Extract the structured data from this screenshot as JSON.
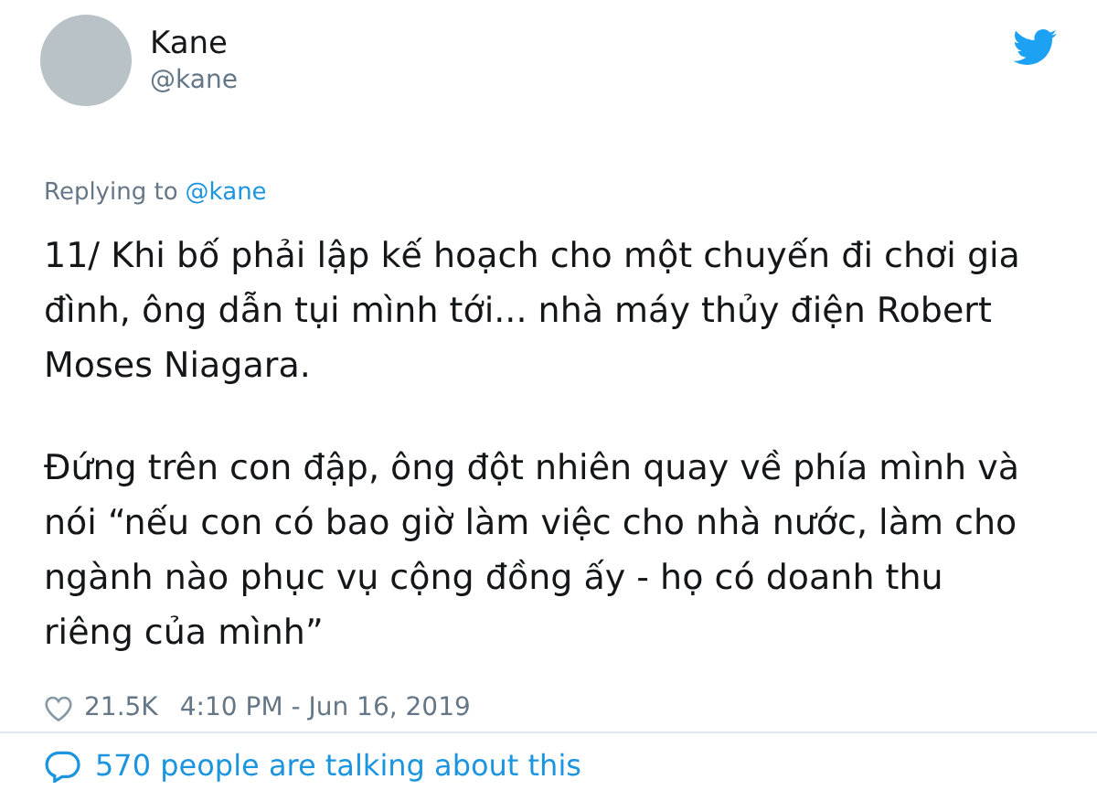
{
  "author": {
    "name": "Kane",
    "handle": "@kane"
  },
  "reply": {
    "label": "Replying to",
    "handle": "@kane"
  },
  "paragraphs": [
    "11/ Khi bố phải lập kế hoạch cho một chuyến đi chơi gia đình, ông dẫn tụi mình tới... nhà máy thủy điện Robert Moses Niagara.",
    "Đứng trên con đập, ông đột nhiên quay về phía mình và nói “nếu con có bao giờ làm việc cho nhà nước, làm cho ngành nào phục vụ cộng đồng ấy - họ có doanh thu riêng của mình”"
  ],
  "likes": "21.5K",
  "timestamp": "4:10 PM - Jun 16, 2019",
  "footer": "570 people are talking about this"
}
